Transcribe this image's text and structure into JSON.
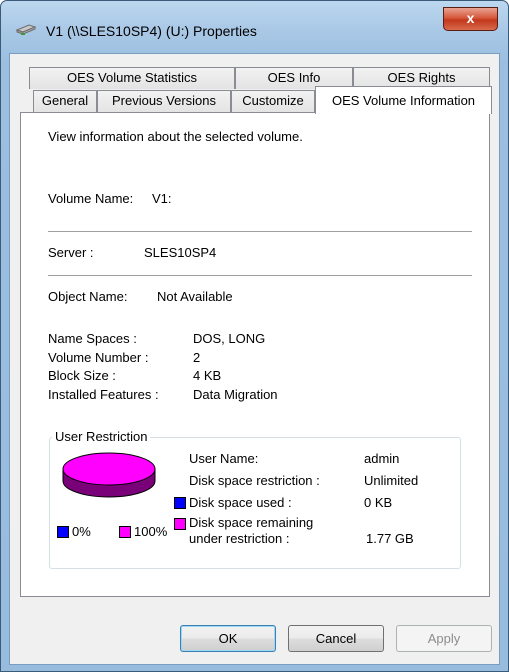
{
  "window": {
    "title": "V1 (\\\\SLES10SP4) (U:) Properties",
    "close_glyph": "x",
    "accent_color": "#c2381c"
  },
  "tabs": {
    "row_top": [
      {
        "label": "OES Volume Statistics"
      },
      {
        "label": "OES Info"
      },
      {
        "label": "OES Rights"
      }
    ],
    "row_bottom": [
      {
        "label": "General"
      },
      {
        "label": "Previous Versions"
      },
      {
        "label": "Customize"
      },
      {
        "label": "OES Volume Information",
        "active": true
      }
    ]
  },
  "panel": {
    "description": "View information about the selected volume.",
    "volume_name_label": "Volume Name:",
    "volume_name_value": "V1:",
    "server_label": "Server :",
    "server_value": "SLES10SP4",
    "object_name_label": "Object Name:",
    "object_name_value": "Not Available",
    "details": [
      {
        "label": "Name Spaces :",
        "value": "DOS, LONG"
      },
      {
        "label": "Volume Number :",
        "value": "2"
      },
      {
        "label": "Block Size :",
        "value": "4 KB"
      },
      {
        "label": "Installed Features :",
        "value": "Data Migration"
      }
    ]
  },
  "user_restriction": {
    "title": "User Restriction",
    "user_name_label": "User Name:",
    "user_name_value": "admin",
    "restriction_label": "Disk space restriction :",
    "restriction_value": "Unlimited",
    "used_label": "Disk space used :",
    "used_value": "0 KB",
    "remaining_label_1": "Disk space remaining",
    "remaining_label_2": "under restriction :",
    "remaining_value": "1.77 GB",
    "legend_used_pct": "0%",
    "legend_remaining_pct": "100%",
    "used_fraction": 0,
    "remaining_fraction": 1,
    "used_color": "#0000ff",
    "remaining_color": "#ff00ff"
  },
  "buttons": {
    "ok": "OK",
    "cancel": "Cancel",
    "apply": "Apply"
  }
}
